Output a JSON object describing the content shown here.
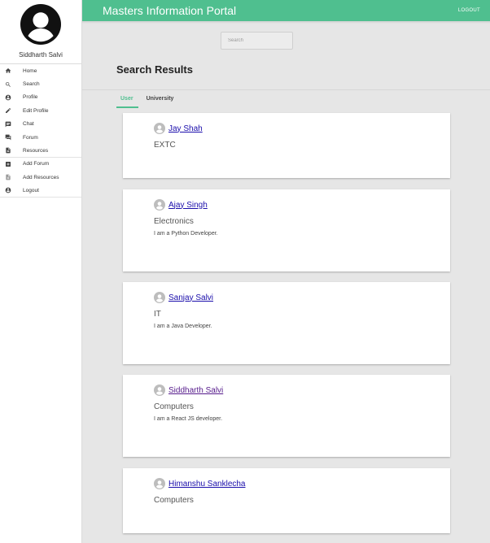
{
  "profile": {
    "name": "Siddharth Salvi"
  },
  "nav": [
    {
      "label": "Home",
      "icon": "home-icon"
    },
    {
      "label": "Search",
      "icon": "search-icon"
    },
    {
      "label": "Profile",
      "icon": "account-circle-icon"
    },
    {
      "label": "Edit Profile",
      "icon": "pencil-icon"
    },
    {
      "label": "Chat",
      "icon": "chat-icon"
    },
    {
      "label": "Forum",
      "icon": "forum-icon"
    },
    {
      "label": "Resources",
      "icon": "document-icon"
    },
    {
      "label": "Add Forum",
      "icon": "add-box-icon"
    },
    {
      "label": "Add Resources",
      "icon": "note-add-icon"
    },
    {
      "label": "Logout",
      "icon": "logout-icon"
    }
  ],
  "header": {
    "title": "Masters Information Portal",
    "logout": "LOGOUT"
  },
  "search": {
    "placeholder": "Search"
  },
  "page": {
    "title": "Search Results"
  },
  "tabs": [
    {
      "label": "User",
      "active": true
    },
    {
      "label": "University",
      "active": false
    }
  ],
  "results": [
    {
      "name": "Jay Shah",
      "dept": "EXTC",
      "bio": ""
    },
    {
      "name": "Ajay Singh",
      "dept": "Electronics",
      "bio": "I am a Python Developer."
    },
    {
      "name": "Sanjay Salvi",
      "dept": "IT",
      "bio": "I am a Java Developer."
    },
    {
      "name": "Siddharth Salvi",
      "dept": "Computers",
      "bio": "I am a React JS developer."
    },
    {
      "name": "Himanshu Sanklecha",
      "dept": "Computers",
      "bio": ""
    }
  ],
  "colors": {
    "accent": "#4fbf8f",
    "link": "#1a0dab",
    "visited_link": "#551a8b",
    "background": "#e6e6e6"
  }
}
